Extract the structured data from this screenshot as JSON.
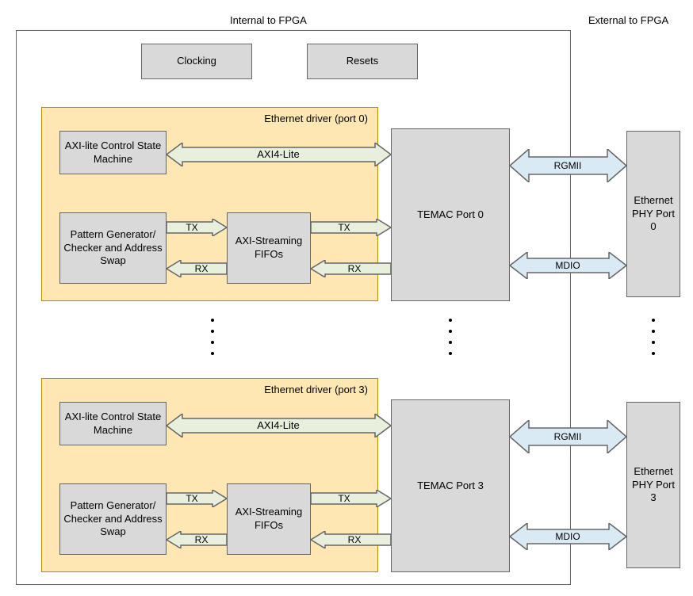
{
  "titles": {
    "internal": "Internal to FPGA",
    "external": "External to FPGA"
  },
  "top_blocks": {
    "clocking": "Clocking",
    "resets": "Resets"
  },
  "driver0": {
    "title": "Ethernet driver (port 0)",
    "axi_sm": "AXI-lite Control State Machine",
    "pattern": "Pattern Generator/ Checker and Address Swap",
    "fifos": "AXI-Streaming FIFOs",
    "temac": "TEMAC Port 0",
    "phy": "Ethernet PHY Port 0",
    "axi4lite": "AXI4-Lite",
    "tx": "TX",
    "rx": "RX",
    "rgmii": "RGMII",
    "mdio": "MDIO"
  },
  "driver3": {
    "title": "Ethernet driver (port 3)",
    "axi_sm": "AXI-lite Control State Machine",
    "pattern": "Pattern Generator/ Checker and Address Swap",
    "fifos": "AXI-Streaming FIFOs",
    "temac": "TEMAC Port 3",
    "phy": "Ethernet PHY Port 3",
    "axi4lite": "AXI4-Lite",
    "tx": "TX",
    "rx": "RX",
    "rgmii": "RGMII",
    "mdio": "MDIO"
  }
}
